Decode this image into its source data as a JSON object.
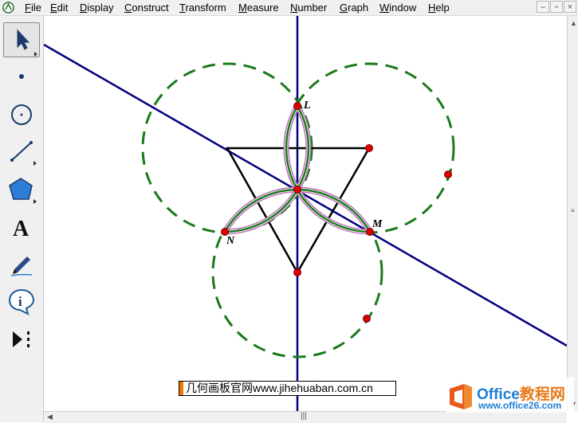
{
  "menubar": {
    "items": [
      {
        "label": "File",
        "hotkey": "F",
        "rest": "ile"
      },
      {
        "label": "Edit",
        "hotkey": "E",
        "rest": "dit"
      },
      {
        "label": "Display",
        "hotkey": "D",
        "rest": "isplay"
      },
      {
        "label": "Construct",
        "hotkey": "C",
        "rest": "onstruct"
      },
      {
        "label": "Transform",
        "hotkey": "T",
        "rest": "ransform"
      },
      {
        "label": "Measure",
        "hotkey": "M",
        "rest": "easure"
      },
      {
        "label": "Number",
        "hotkey": "N",
        "rest": "umber"
      },
      {
        "label": "Graph",
        "hotkey": "G",
        "rest": "raph"
      },
      {
        "label": "Window",
        "hotkey": "W",
        "rest": "indow"
      },
      {
        "label": "Help",
        "hotkey": "H",
        "rest": "elp"
      }
    ],
    "window_buttons": {
      "minimize": "–",
      "restore": "▫",
      "close": "×"
    }
  },
  "toolbox": {
    "tools": [
      {
        "name": "arrow-select-tool",
        "icon": "arrow-icon",
        "selected": true
      },
      {
        "name": "point-tool",
        "icon": "point-icon"
      },
      {
        "name": "compass-tool",
        "icon": "compass-circle-icon"
      },
      {
        "name": "straightedge-tool",
        "icon": "segment-icon"
      },
      {
        "name": "polygon-tool",
        "icon": "pentagon-icon"
      },
      {
        "name": "text-tool",
        "icon": "text-a-icon",
        "glyph": "A"
      },
      {
        "name": "marker-tool",
        "icon": "pen-marker-icon"
      },
      {
        "name": "information-tool",
        "icon": "info-icon",
        "glyph": "i"
      },
      {
        "name": "custom-tool",
        "icon": "custom-tools-icon"
      }
    ]
  },
  "sketch": {
    "point_labels": [
      "L",
      "M",
      "N"
    ],
    "colors": {
      "line": "#000080",
      "triangle": "#000000",
      "circle": "#1a7a1a",
      "point": "#dd0000",
      "arc_outer": "#c070c0",
      "arc_inner": "#1a7a1a"
    }
  },
  "watermark": {
    "caption": "几何画板官网www.jihehuaban.com.cn",
    "brand_name_latin": "Office",
    "brand_name_cn": "教程网",
    "brand_url": "www.office26.com"
  }
}
